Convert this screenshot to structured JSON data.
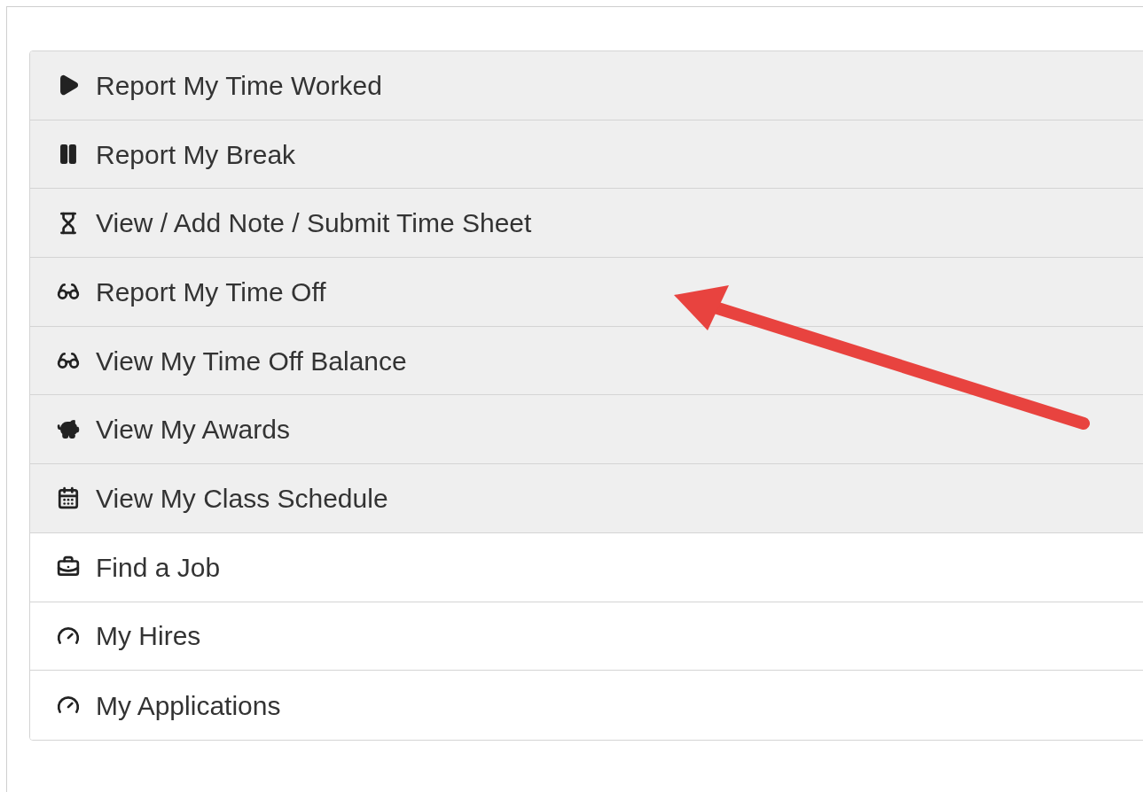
{
  "menu": {
    "items": [
      {
        "label": "Report My Time Worked",
        "kind": "play",
        "shaded": true
      },
      {
        "label": "Report My Break",
        "kind": "pause",
        "shaded": true
      },
      {
        "label": "View / Add Note / Submit Time Sheet",
        "kind": "hourglass",
        "shaded": true
      },
      {
        "label": "Report My Time Off",
        "kind": "glasses",
        "shaded": true
      },
      {
        "label": "View My Time Off Balance",
        "kind": "glasses",
        "shaded": true
      },
      {
        "label": "View My Awards",
        "kind": "piggy",
        "shaded": true
      },
      {
        "label": "View My Class Schedule",
        "kind": "calendar",
        "shaded": true
      },
      {
        "label": "Find a Job",
        "kind": "briefcase",
        "shaded": false
      },
      {
        "label": "My Hires",
        "kind": "gauge",
        "shaded": false
      },
      {
        "label": "My Applications",
        "kind": "gauge",
        "shaded": false
      }
    ]
  }
}
